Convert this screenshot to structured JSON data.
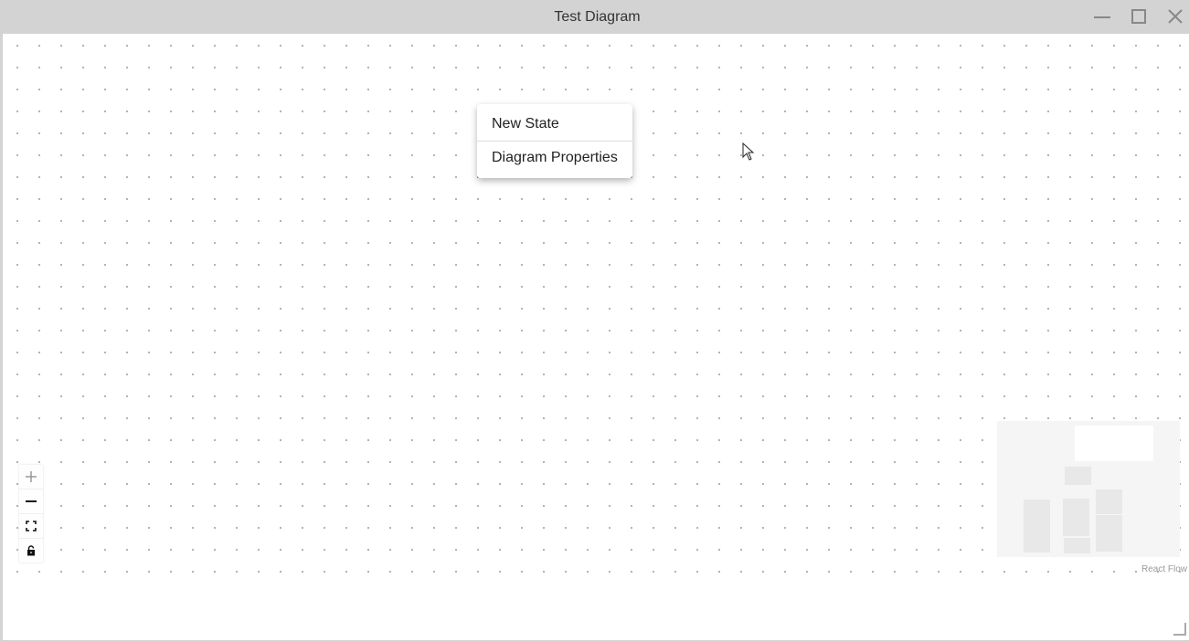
{
  "window": {
    "title": "Test Diagram"
  },
  "context_menu": {
    "items": [
      {
        "label": "New State"
      },
      {
        "label": "Diagram Properties"
      }
    ]
  },
  "controls": {
    "icons": [
      "plus-icon",
      "minus-icon",
      "fit-view-icon",
      "lock-icon"
    ]
  },
  "attribution": "React Flow"
}
